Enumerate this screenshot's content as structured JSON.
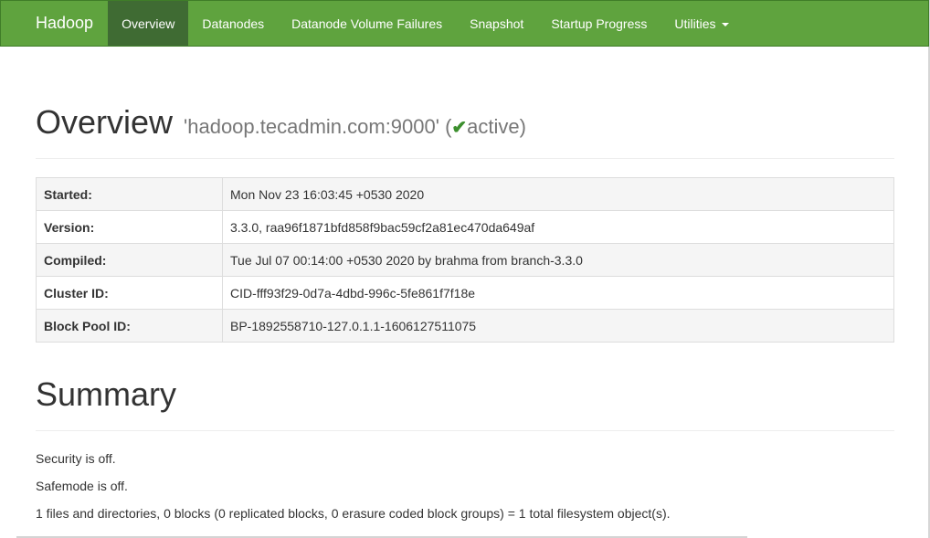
{
  "nav": {
    "brand": "Hadoop",
    "items": [
      {
        "label": "Overview"
      },
      {
        "label": "Datanodes"
      },
      {
        "label": "Datanode Volume Failures"
      },
      {
        "label": "Snapshot"
      },
      {
        "label": "Startup Progress"
      },
      {
        "label": "Utilities"
      }
    ],
    "active": "Overview"
  },
  "overview": {
    "title": "Overview",
    "host": "'hadoop.tecadmin.com:9000'",
    "paren_open": " (",
    "check": "✔",
    "status": "active",
    "paren_close": ")"
  },
  "info": [
    {
      "key": "Started:",
      "value": "Mon Nov 23 16:03:45 +0530 2020"
    },
    {
      "key": "Version:",
      "value": "3.3.0, raa96f1871bfd858f9bac59cf2a81ec470da649af"
    },
    {
      "key": "Compiled:",
      "value": "Tue Jul 07 00:14:00 +0530 2020 by brahma from branch-3.3.0"
    },
    {
      "key": "Cluster ID:",
      "value": "CID-fff93f29-0d7a-4dbd-996c-5fe861f7f18e"
    },
    {
      "key": "Block Pool ID:",
      "value": "BP-1892558710-127.0.1.1-1606127511075"
    }
  ],
  "summary": {
    "title": "Summary",
    "lines": [
      "Security is off.",
      "Safemode is off.",
      "1 files and directories, 0 blocks (0 replicated blocks, 0 erasure coded block groups) = 1 total filesystem object(s)."
    ]
  },
  "colors": {
    "navbar": "#5fa33e",
    "nav_active": "#3f6b33",
    "status_check": "#3c8f2e"
  }
}
